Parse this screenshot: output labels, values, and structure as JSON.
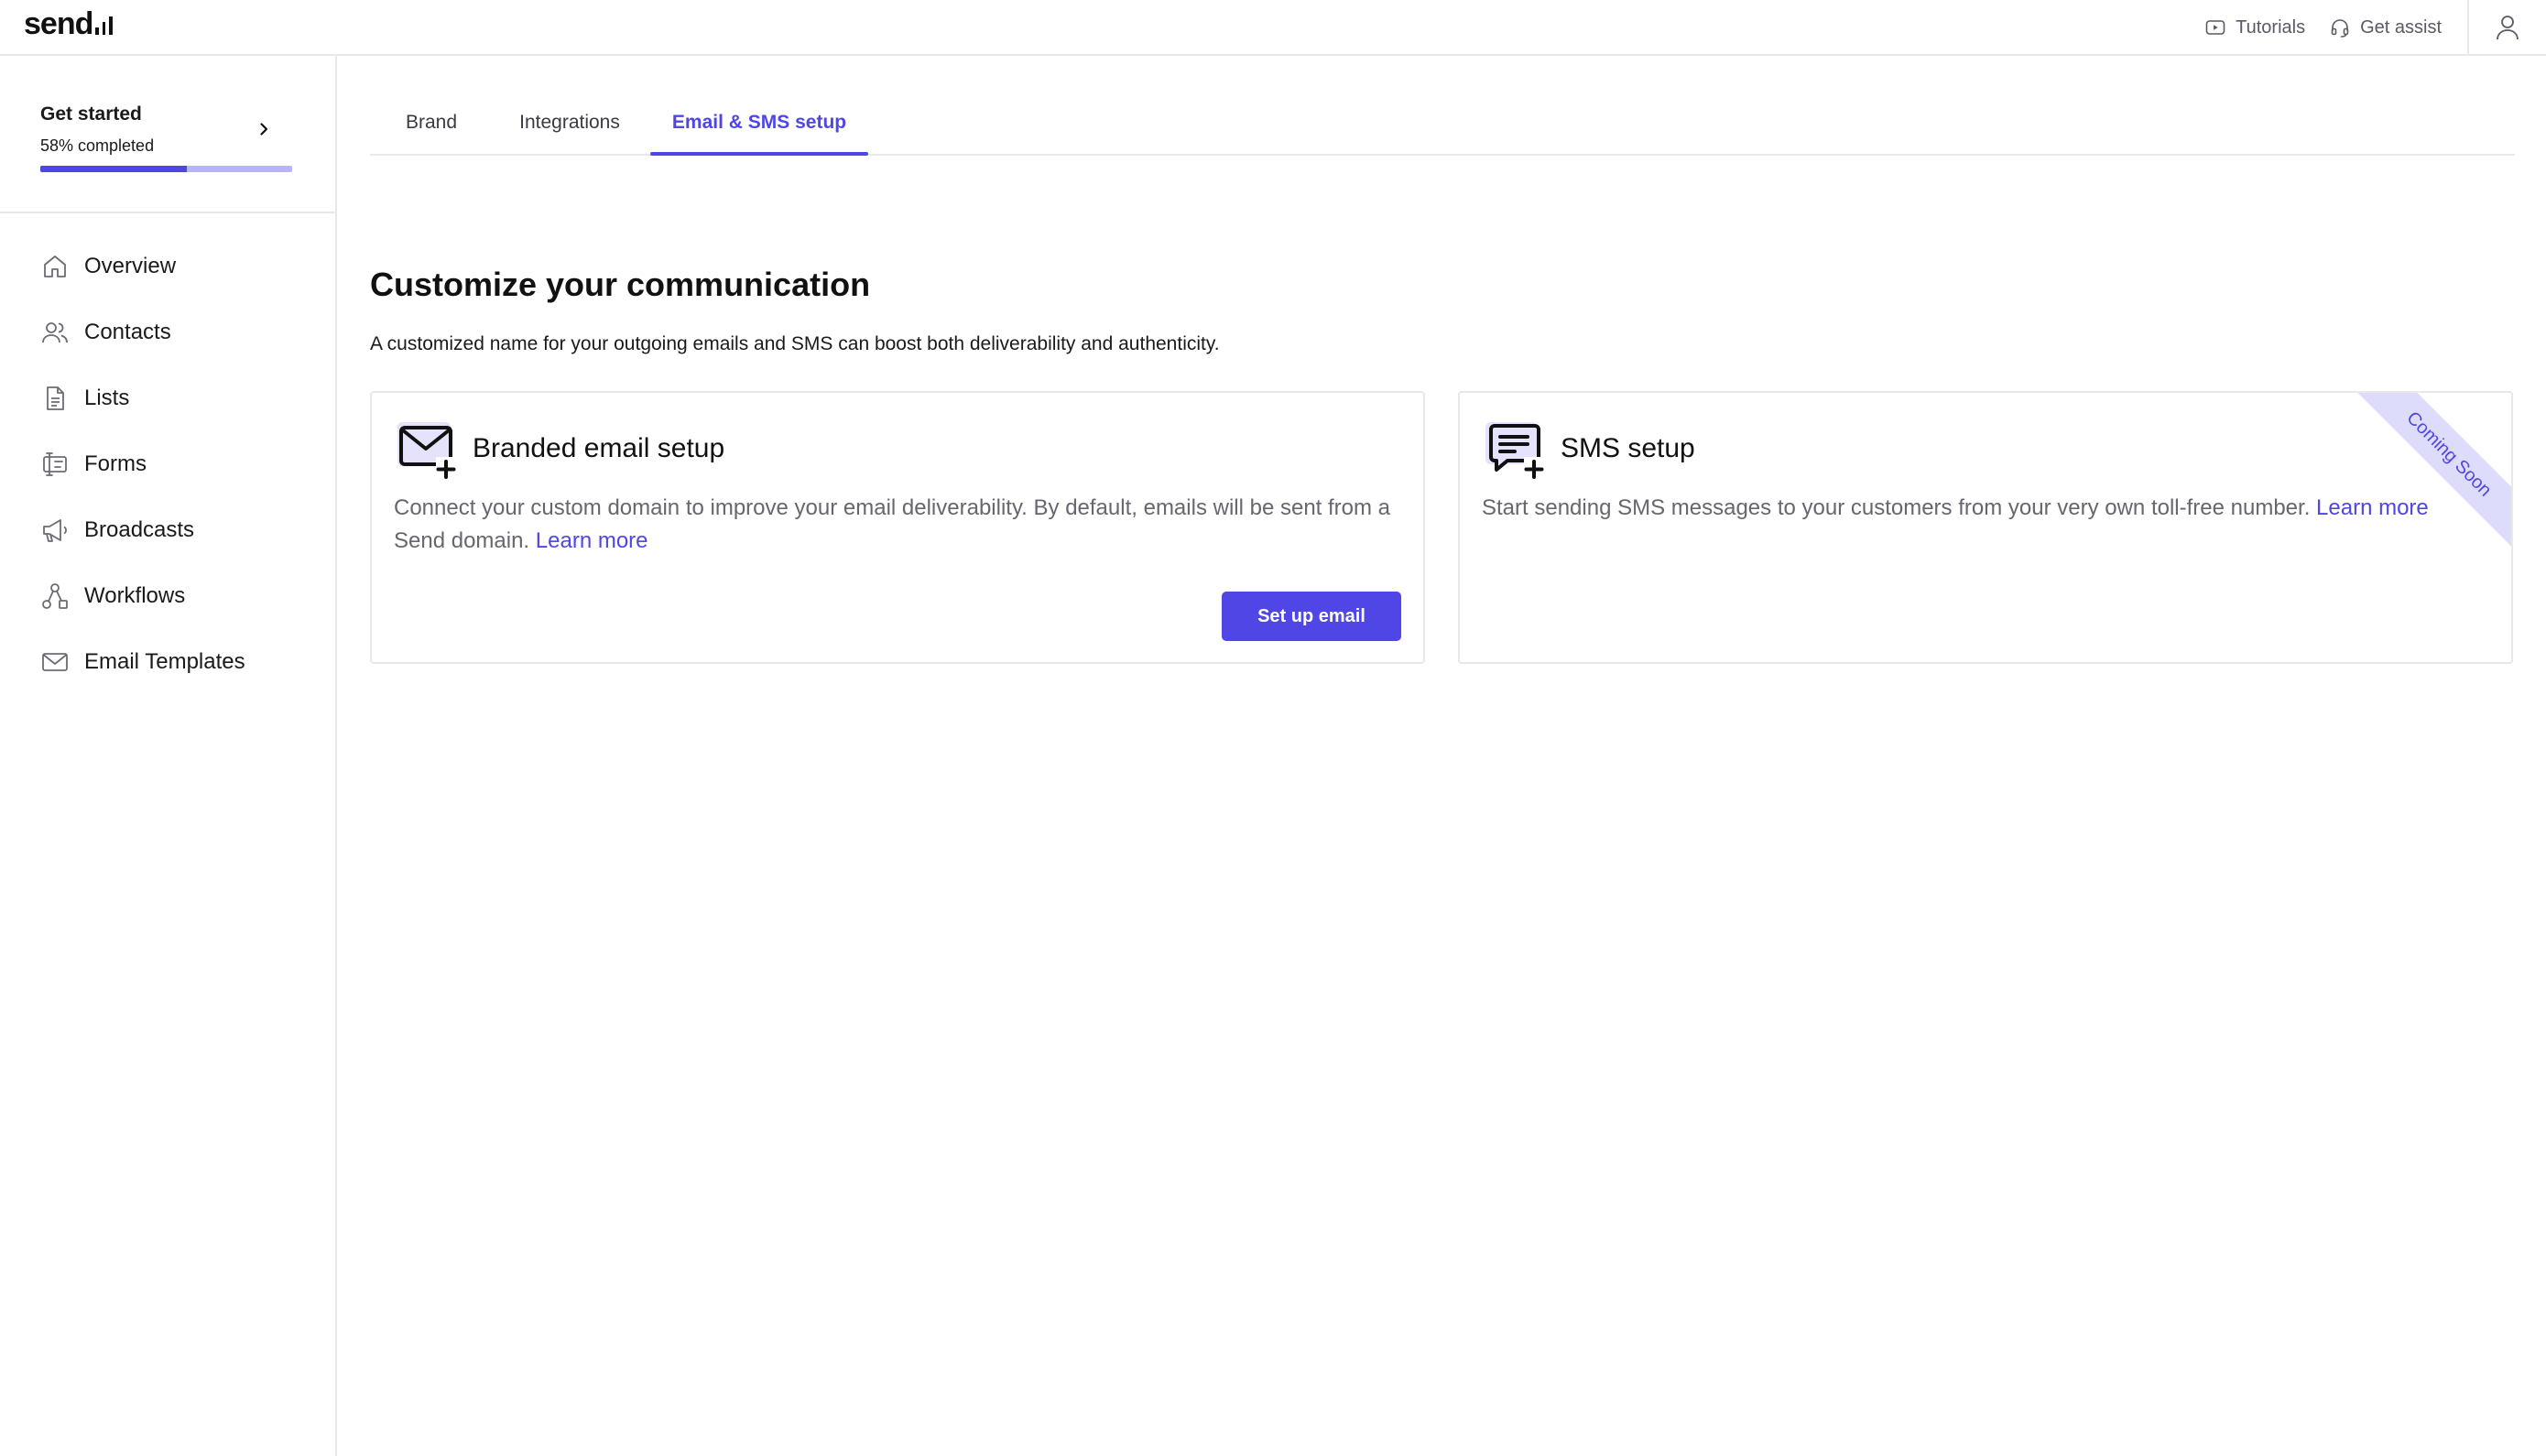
{
  "app": {
    "logo_text": "send"
  },
  "header": {
    "tutorials_label": "Tutorials",
    "get_assist_label": "Get assist"
  },
  "sidebar": {
    "get_started": {
      "title": "Get started",
      "progress_label": "58% completed",
      "progress_fraction": 0.58
    },
    "items": [
      {
        "label": "Overview",
        "icon": "home-icon"
      },
      {
        "label": "Contacts",
        "icon": "users-icon"
      },
      {
        "label": "Lists",
        "icon": "document-list-icon"
      },
      {
        "label": "Forms",
        "icon": "form-icon"
      },
      {
        "label": "Broadcasts",
        "icon": "megaphone-icon"
      },
      {
        "label": "Workflows",
        "icon": "workflow-icon"
      },
      {
        "label": "Email Templates",
        "icon": "envelope-icon"
      }
    ]
  },
  "tabs": [
    {
      "label": "Brand",
      "active": false
    },
    {
      "label": "Integrations",
      "active": false
    },
    {
      "label": "Email & SMS setup",
      "active": true
    }
  ],
  "main": {
    "title": "Customize your communication",
    "subtitle": "A customized name for your outgoing emails and SMS can boost both deliverability and authenticity.",
    "email_card": {
      "title": "Branded email setup",
      "description": "Connect your custom domain to improve your email deliverability. By default, emails will be sent from a Send domain.",
      "learn_more": "Learn more",
      "button_label": "Set up email"
    },
    "sms_card": {
      "title": "SMS setup",
      "description": "Start sending SMS messages to your customers from your very own toll-free number.",
      "learn_more": "Learn more",
      "badge": "Coming Soon"
    }
  },
  "colors": {
    "accent": "#4f46e5",
    "progress_track": "#b8b5f5",
    "ribbon_bg": "#dddcfa",
    "border": "#e8e8ea",
    "muted_text": "#66666f"
  }
}
